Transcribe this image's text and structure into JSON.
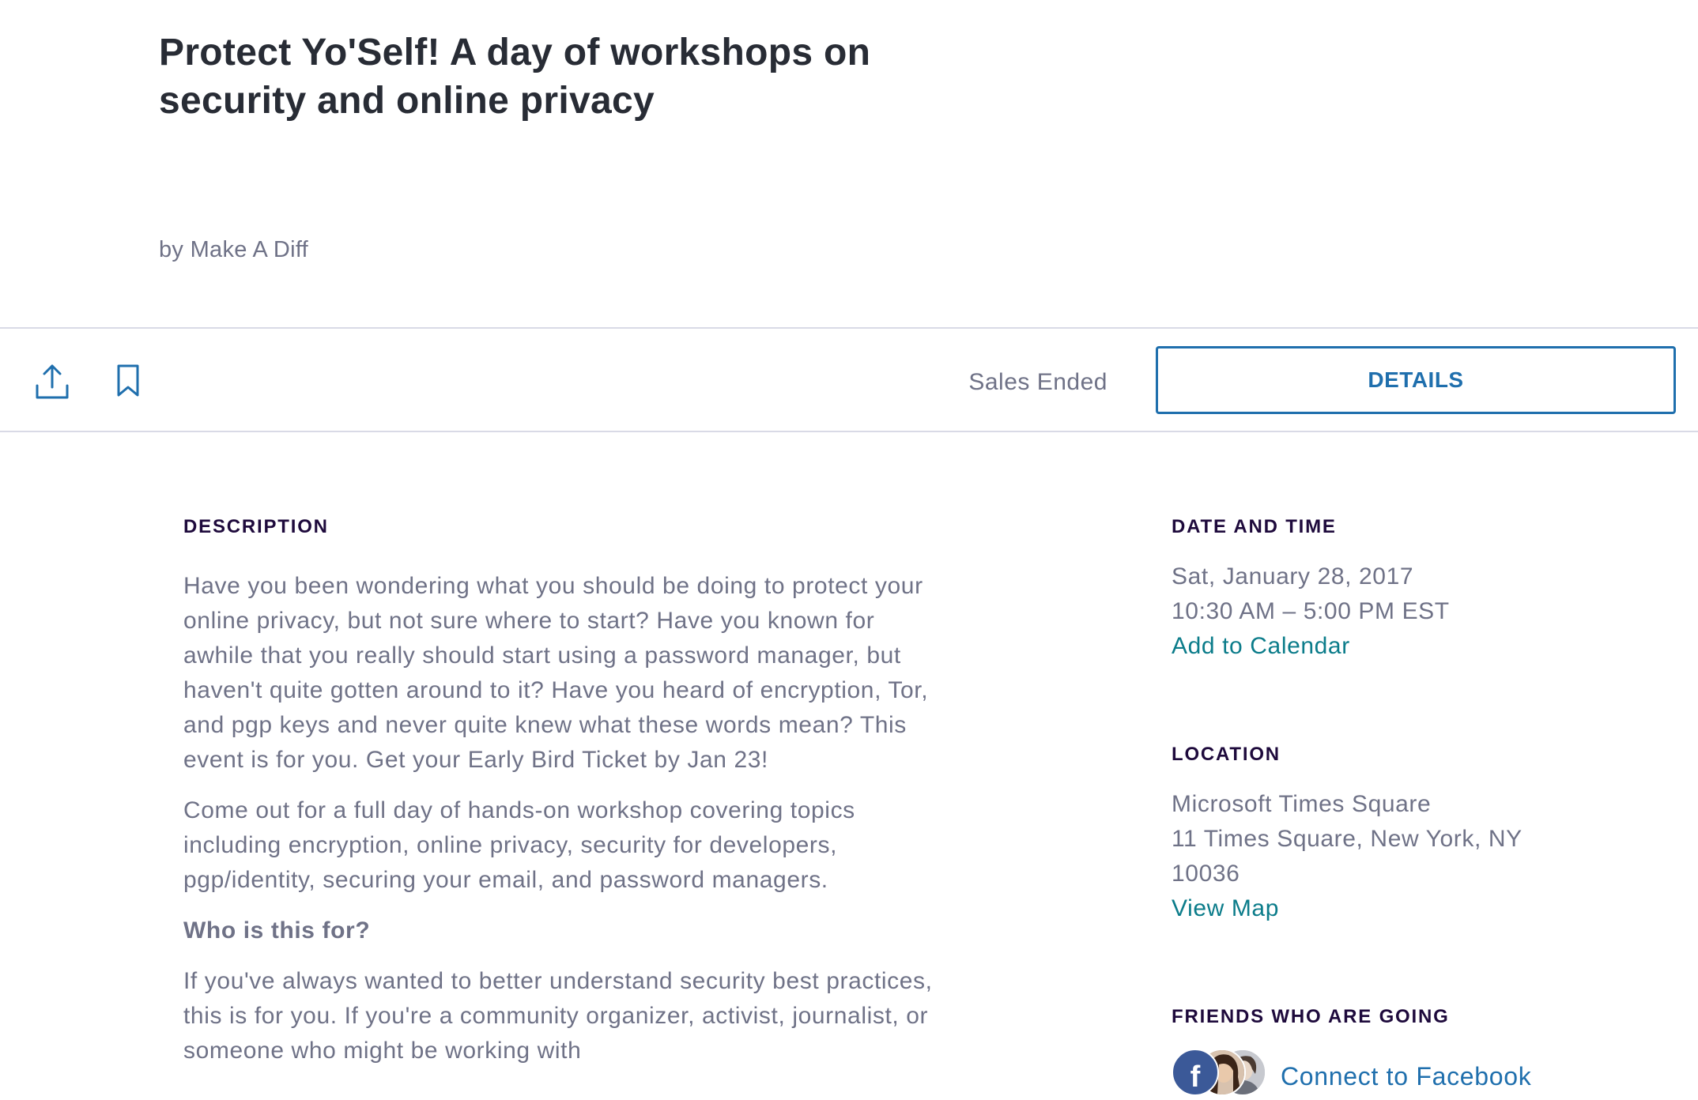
{
  "event": {
    "title": "Protect Yo'Self! A day of workshops on security and online privacy",
    "organizer": "by Make A Diff"
  },
  "action_bar": {
    "share_icon": "share-upload-icon",
    "bookmark_icon": "bookmark-icon",
    "sales_status": "Sales Ended",
    "details_label": "DETAILS",
    "accent_color": "#1f6fad"
  },
  "description": {
    "label": "DESCRIPTION",
    "paragraphs": [
      "Have you been wondering what you should be doing to protect your online privacy, but not sure where to start? Have you known for awhile that you really should start using a password manager, but haven't quite gotten around to it? Have you heard of encryption, Tor, and pgp keys and never quite knew what these words mean? This event is for you. Get your Early Bird Ticket by Jan 23!",
      "Come out for a full day of hands-on workshop covering topics including encryption, online privacy, security for developers, pgp/identity, securing your email, and password managers."
    ],
    "subheading": "Who is this for?",
    "paragraph_3": "If you've always wanted to better understand security best practices, this is for you. If you're a community organizer, activist, journalist, or someone who might be working with"
  },
  "date_time": {
    "label": "DATE AND TIME",
    "date": "Sat, January 28, 2017",
    "time": "10:30 AM – 5:00 PM EST",
    "calendar_link": "Add to Calendar"
  },
  "location": {
    "label": "LOCATION",
    "venue": "Microsoft Times Square",
    "address_line": "11 Times Square, New York, NY",
    "zip": "10036",
    "map_link": "View Map"
  },
  "friends": {
    "label": "FRIENDS WHO ARE GOING",
    "facebook_glyph": "f",
    "connect_link": "Connect to Facebook",
    "facebook_color": "#3b5998",
    "link_color": "#0b7c8a"
  }
}
